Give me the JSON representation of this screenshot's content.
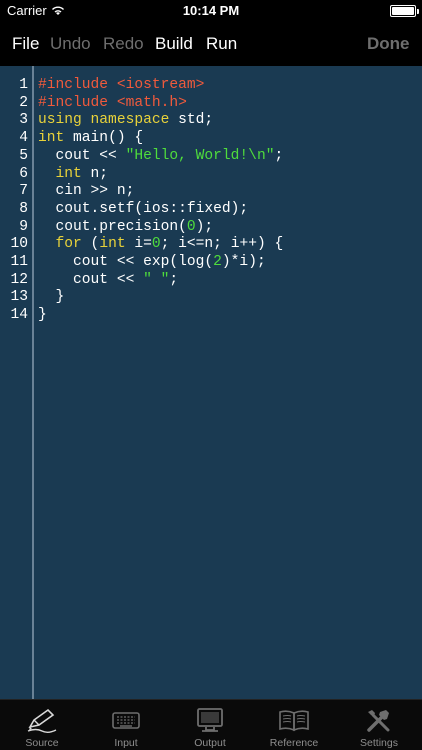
{
  "status_bar": {
    "carrier": "Carrier",
    "time": "10:14 PM",
    "battery_level": 1.0
  },
  "toolbar": {
    "file": "File",
    "undo": "Undo",
    "redo": "Redo",
    "build": "Build",
    "run": "Run",
    "done": "Done"
  },
  "editor": {
    "lines": [
      {
        "num": "1",
        "tokens": [
          {
            "t": "#include <iostream>",
            "c": "pp"
          }
        ]
      },
      {
        "num": "2",
        "tokens": [
          {
            "t": "#include <math.h>",
            "c": "pp"
          }
        ]
      },
      {
        "num": "3",
        "tokens": [
          {
            "t": "using namespace",
            "c": "kw"
          },
          {
            "t": " std;",
            "c": ""
          }
        ]
      },
      {
        "num": "4",
        "tokens": [
          {
            "t": "int",
            "c": "kw"
          },
          {
            "t": " main() {",
            "c": ""
          }
        ]
      },
      {
        "num": "5",
        "tokens": [
          {
            "t": "  cout << ",
            "c": ""
          },
          {
            "t": "\"Hello, World!\\n\"",
            "c": "str"
          },
          {
            "t": ";",
            "c": ""
          }
        ]
      },
      {
        "num": "6",
        "tokens": [
          {
            "t": "  ",
            "c": ""
          },
          {
            "t": "int",
            "c": "kw"
          },
          {
            "t": " n;",
            "c": ""
          }
        ]
      },
      {
        "num": "7",
        "tokens": [
          {
            "t": "  cin >> n;",
            "c": ""
          }
        ]
      },
      {
        "num": "8",
        "tokens": [
          {
            "t": "  cout.setf(ios::fixed);",
            "c": ""
          }
        ]
      },
      {
        "num": "9",
        "tokens": [
          {
            "t": "  cout.precision(",
            "c": ""
          },
          {
            "t": "0",
            "c": "num"
          },
          {
            "t": ");",
            "c": ""
          }
        ]
      },
      {
        "num": "10",
        "tokens": [
          {
            "t": "  ",
            "c": ""
          },
          {
            "t": "for",
            "c": "kw"
          },
          {
            "t": " (",
            "c": ""
          },
          {
            "t": "int",
            "c": "kw"
          },
          {
            "t": " i=",
            "c": ""
          },
          {
            "t": "0",
            "c": "num"
          },
          {
            "t": "; i<=n; i++) {",
            "c": ""
          }
        ]
      },
      {
        "num": "11",
        "tokens": [
          {
            "t": "    cout << exp(log(",
            "c": ""
          },
          {
            "t": "2",
            "c": "num"
          },
          {
            "t": ")*i);",
            "c": ""
          }
        ]
      },
      {
        "num": "12",
        "tokens": [
          {
            "t": "    cout << ",
            "c": ""
          },
          {
            "t": "\" \"",
            "c": "str"
          },
          {
            "t": ";",
            "c": ""
          }
        ]
      },
      {
        "num": "13",
        "tokens": [
          {
            "t": "  }",
            "c": ""
          }
        ]
      },
      {
        "num": "14",
        "tokens": [
          {
            "t": "}",
            "c": ""
          }
        ]
      }
    ]
  },
  "tabs": [
    {
      "label": "Source",
      "icon": "pen-icon",
      "active": true
    },
    {
      "label": "Input",
      "icon": "keyboard-icon",
      "active": false
    },
    {
      "label": "Output",
      "icon": "monitor-icon",
      "active": false
    },
    {
      "label": "Reference",
      "icon": "book-icon",
      "active": false
    },
    {
      "label": "Settings",
      "icon": "tools-icon",
      "active": false
    }
  ],
  "colors": {
    "editor_bg": "#1a3a52",
    "preprocessor": "#f05a3c",
    "keyword": "#e8d23a",
    "string": "#4fdc3c"
  }
}
